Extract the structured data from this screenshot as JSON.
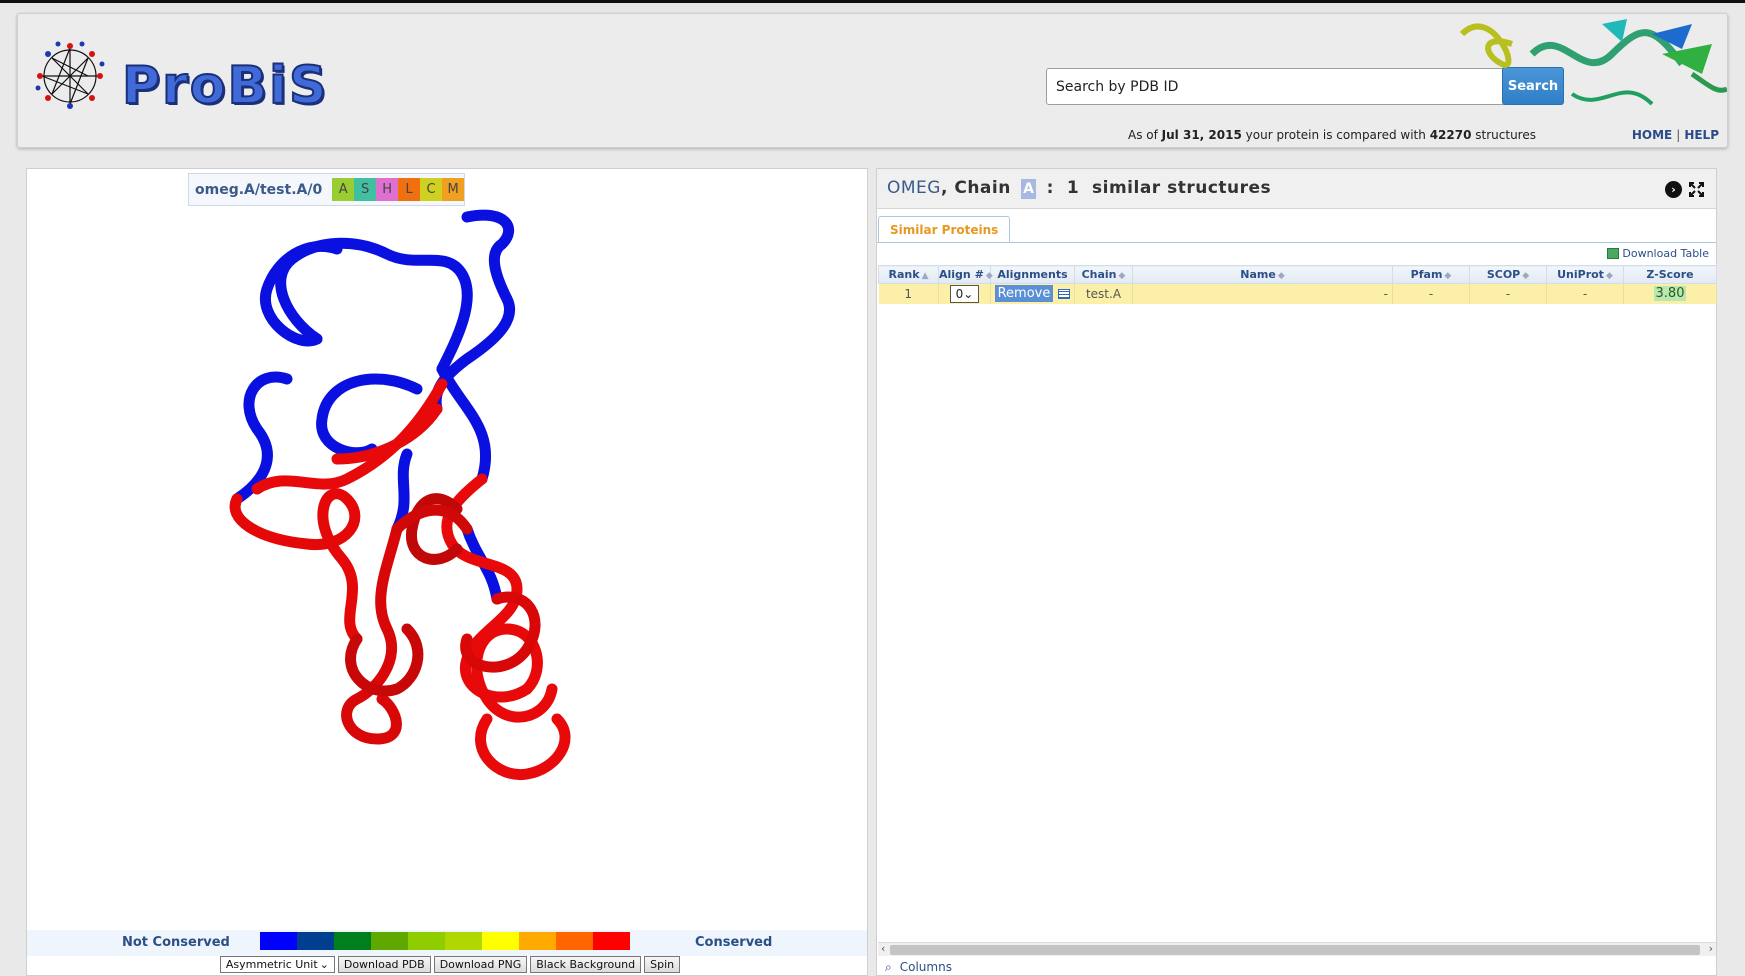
{
  "brand": {
    "name": "ProBiS"
  },
  "search": {
    "placeholder": "Search by PDB ID",
    "button_label": "Search"
  },
  "status": {
    "prefix": "As of",
    "date": "Jul 31, 2015",
    "middle": "your protein is compared with",
    "count": "42270",
    "suffix": "structures"
  },
  "nav": {
    "home": "HOME",
    "separator": "|",
    "help": "HELP"
  },
  "viewer": {
    "chain_label": "omeg.A/test.A/0",
    "style_buttons": [
      {
        "label": "A",
        "color": "#9acd32"
      },
      {
        "label": "S",
        "color": "#40c0a0"
      },
      {
        "label": "H",
        "color": "#e070d0"
      },
      {
        "label": "L",
        "color": "#f07010"
      },
      {
        "label": "C",
        "color": "#d0d020"
      },
      {
        "label": "M",
        "color": "#f0a020"
      }
    ],
    "legend": {
      "left": "Not Conserved",
      "right": "Conserved",
      "colors": [
        "#0000ff",
        "#003f8f",
        "#007f1f",
        "#5fa800",
        "#8fcc00",
        "#b0d800",
        "#ffff00",
        "#ffaa00",
        "#ff6600",
        "#ff0000"
      ]
    },
    "controls": {
      "unit_select": "Asymmetric Unit",
      "download_pdb": "Download PDB",
      "download_png": "Download PNG",
      "black_background": "Black Background",
      "spin": "Spin"
    }
  },
  "results": {
    "protein": "OMEG",
    "chain_word": ", Chain",
    "chain": "A",
    "colon": ":",
    "count": "1",
    "label": "similar structures",
    "tab": "Similar Proteins",
    "download_table": "Download Table",
    "columns": [
      "Rank",
      "Align #",
      "Alignments",
      "Chain",
      "Name",
      "Pfam",
      "SCOP",
      "UniProt",
      "Z-Score"
    ],
    "rows": [
      {
        "rank": "1",
        "align": "0",
        "alignment_button": "Remove",
        "chain": "test.A",
        "name": "-",
        "pfam": "-",
        "scop": "-",
        "uniprot": "-",
        "zscore": "3.80"
      }
    ],
    "columns_link": "Columns"
  }
}
